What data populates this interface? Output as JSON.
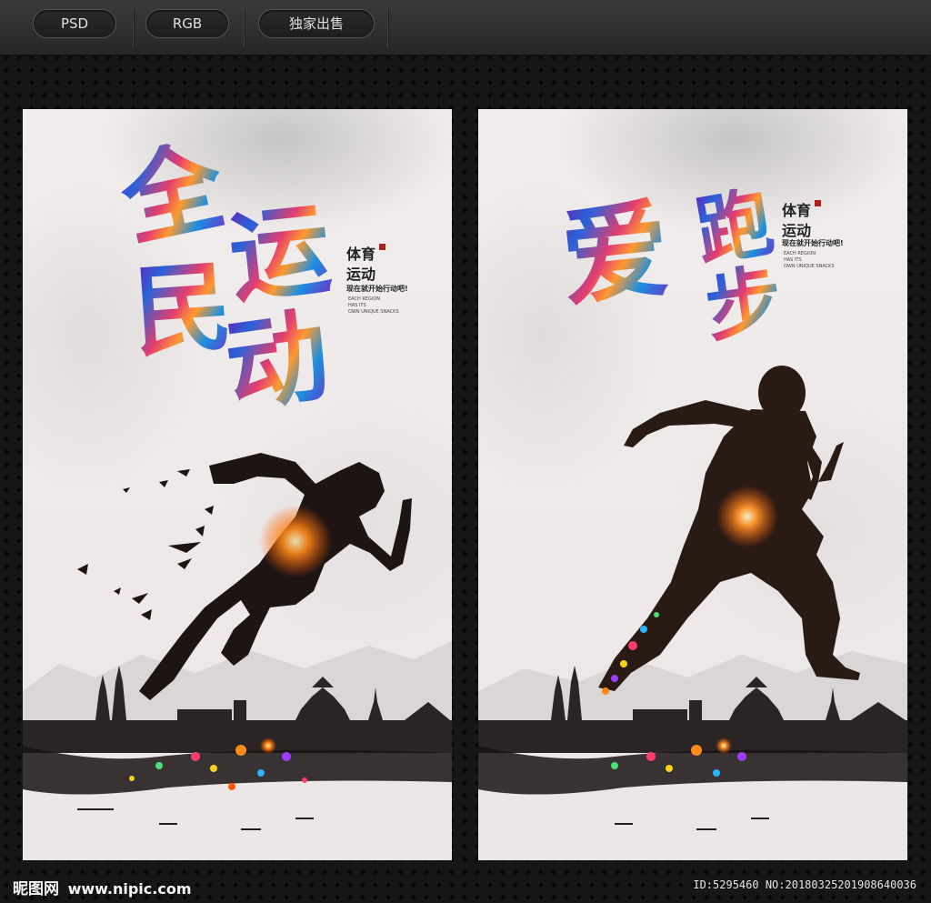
{
  "toolbar": {
    "tags": [
      "PSD",
      "RGB",
      "独家出售"
    ]
  },
  "posters": [
    {
      "title_chars": [
        "全",
        "民",
        "运",
        "动"
      ],
      "side_title": [
        "体育",
        "运动"
      ],
      "slogan": "现在就开始行动吧!",
      "english": [
        "EACH REGION",
        "HAS ITS",
        "OWN UNIQUE SNACKS"
      ]
    },
    {
      "title_chars": [
        "爱",
        "跑",
        "步"
      ],
      "side_title": [
        "体育",
        "运动"
      ],
      "slogan": "现在就开始行动吧!",
      "english": [
        "EACH REGION",
        "HAS ITS",
        "OWN UNIQUE SNACKS"
      ]
    }
  ],
  "footer": {
    "brand_cn": "昵图网",
    "brand_url": "www.nipic.com",
    "id_text": "ID:5295460 NO:20180325201908640036"
  },
  "colors": {
    "background": "#161616",
    "poster_paper": "#efe9e9",
    "accent_purple": "#6a1fb5",
    "accent_blue": "#2a62d9",
    "accent_orange": "#ff9a2e",
    "accent_pink": "#e53d6f"
  }
}
